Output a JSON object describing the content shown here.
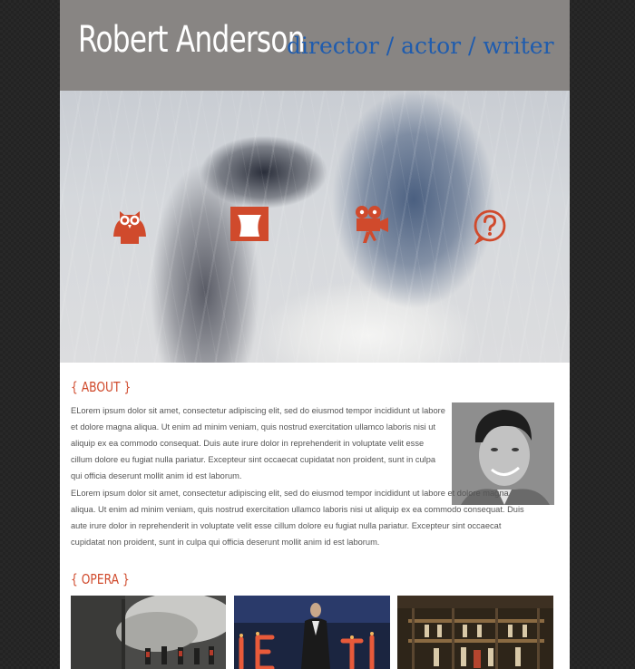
{
  "header": {
    "name": "Robert Anderson",
    "tagline": "director / actor / writer"
  },
  "hero": {
    "icons": [
      {
        "name": "owl-icon"
      },
      {
        "name": "stage-icon"
      },
      {
        "name": "film-camera-icon"
      },
      {
        "name": "question-bubble-icon"
      }
    ],
    "accent_color": "#d04a2c"
  },
  "about": {
    "heading": "{ ABOUT }",
    "para1": "ELorem ipsum dolor sit amet, consectetur adipiscing elit, sed do eiusmod tempor incididunt ut labore et dolore magna aliqua. Ut enim ad minim veniam, quis nostrud exercitation ullamco laboris nisi ut aliquip ex ea commodo consequat. Duis aute irure dolor in reprehenderit in voluptate velit esse cillum dolore eu fugiat nulla pariatur. Excepteur sint occaecat cupidatat non proident, sunt in culpa qui officia deserunt mollit anim id est laborum.",
    "para2": "ELorem ipsum dolor sit amet, consectetur adipiscing elit, sed do eiusmod tempor incididunt ut labore et dolore magna aliqua. Ut enim ad minim veniam, quis nostrud exercitation ullamco laboris nisi ut aliquip ex ea commodo consequat. Duis aute irure dolor in reprehenderit in voluptate velit esse cillum dolore eu fugiat nulla pariatur. Excepteur sint occaecat cupidatat non proident, sunt in culpa qui officia deserunt mollit anim id est laborum."
  },
  "opera": {
    "heading": "{ OPERA }"
  },
  "colors": {
    "header_bg": "#888583",
    "tagline": "#1f5cae",
    "accent": "#d04a2c"
  }
}
